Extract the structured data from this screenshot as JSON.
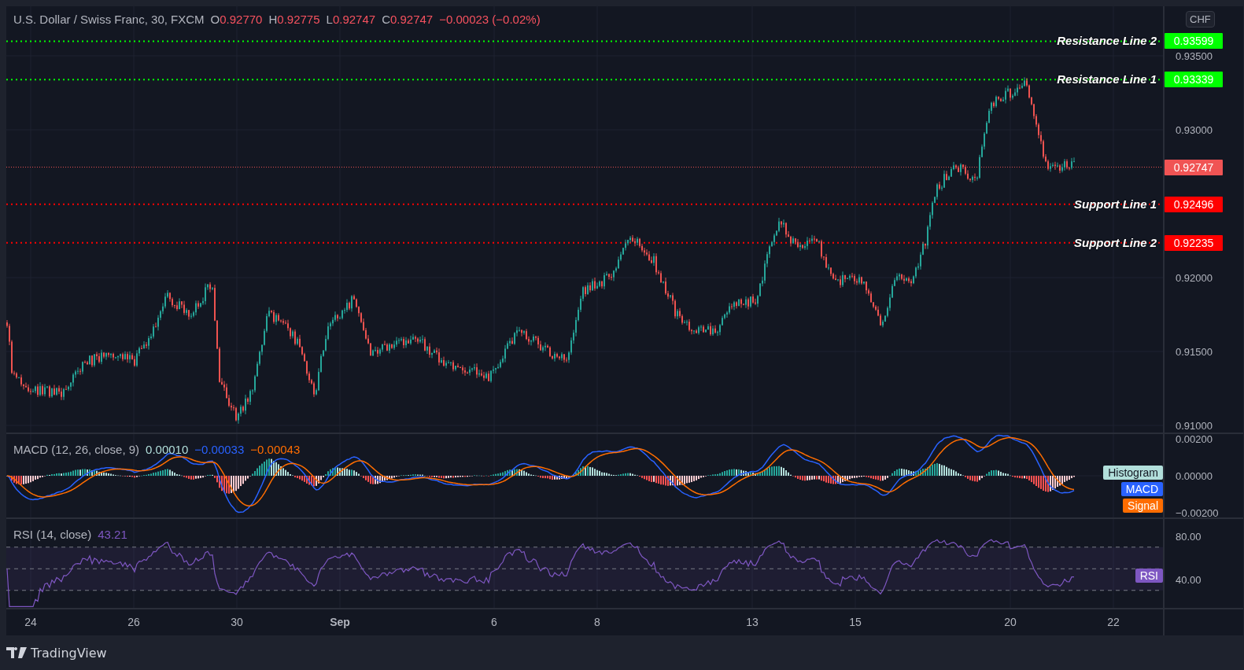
{
  "header": {
    "symbol": "U.S. Dollar / Swiss Franc, 30, FXCM",
    "ohlc": [
      {
        "label": "O",
        "value": "0.92770"
      },
      {
        "label": "H",
        "value": "0.92775"
      },
      {
        "label": "L",
        "value": "0.92747"
      },
      {
        "label": "C",
        "value": "0.92747"
      }
    ],
    "change": "−0.00023 (−0.02%)"
  },
  "currency_button": "CHF",
  "price_axis": {
    "ticks": [
      "0.93500",
      "0.93000",
      "0.92000",
      "0.91500",
      "0.91000"
    ]
  },
  "price_lines": [
    {
      "kind": "labeled",
      "label": "Resistance Line 2",
      "price": "0.93599",
      "color": "#00ff00"
    },
    {
      "kind": "labeled",
      "label": "Resistance Line 1",
      "price": "0.93339",
      "color": "#00ff00"
    },
    {
      "kind": "last_price",
      "price": "0.92747",
      "color": "#f05454"
    },
    {
      "kind": "labeled",
      "label": "Support Line 1",
      "price": "0.92496",
      "color": "#ff0000"
    },
    {
      "kind": "labeled",
      "label": "Support Line 2",
      "price": "0.92235",
      "color": "#ff0000"
    }
  ],
  "macd": {
    "title": "MACD (12, 26, close, 9)",
    "values": [
      {
        "value": "0.00010",
        "color": "#b2dfdb"
      },
      {
        "value": "−0.00033",
        "color": "#2962ff"
      },
      {
        "value": "−0.00043",
        "color": "#ff6d00"
      }
    ],
    "axis_ticks": [
      "0.00200",
      "0.00000",
      "−0.00200"
    ],
    "tags": [
      {
        "label": "Histogram",
        "color": "#b2dfdb"
      },
      {
        "label": "MACD",
        "color": "#2962ff"
      },
      {
        "label": "Signal",
        "color": "#ff6d00"
      }
    ]
  },
  "rsi": {
    "title": "RSI (14, close)",
    "value": "43.21",
    "color": "#7e57c2",
    "axis_ticks": [
      "80.00",
      "40.00"
    ],
    "tag": "RSI"
  },
  "time_axis": [
    {
      "kind": "day",
      "label": "24"
    },
    {
      "kind": "day",
      "label": "26"
    },
    {
      "kind": "day",
      "label": "30"
    },
    {
      "kind": "month",
      "label": "Sep"
    },
    {
      "kind": "day",
      "label": "6"
    },
    {
      "kind": "day",
      "label": "8"
    },
    {
      "kind": "day",
      "label": "13"
    },
    {
      "kind": "day",
      "label": "15"
    },
    {
      "kind": "day",
      "label": "20"
    },
    {
      "kind": "day",
      "label": "22"
    }
  ],
  "footer": {
    "brand": "TradingView"
  }
}
